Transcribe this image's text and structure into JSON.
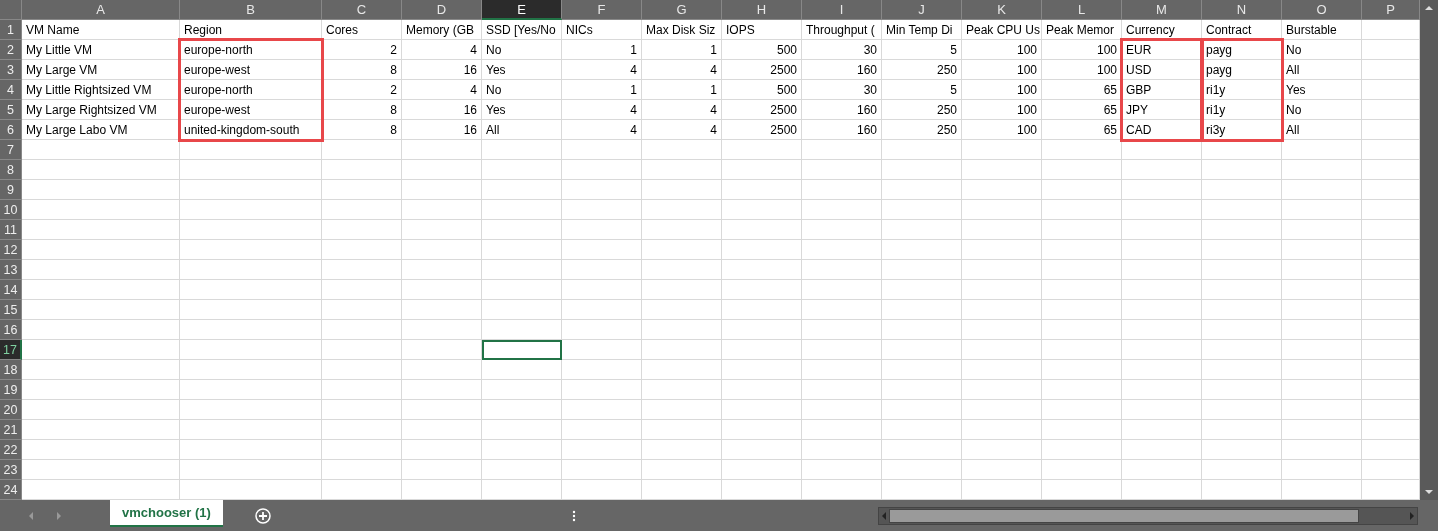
{
  "columns": [
    {
      "letter": "A",
      "header": "VM Name",
      "kind": "text",
      "selected": false,
      "highlighted": false
    },
    {
      "letter": "B",
      "header": "Region",
      "kind": "text",
      "selected": false,
      "highlighted": true
    },
    {
      "letter": "C",
      "header": "Cores",
      "kind": "number",
      "selected": false,
      "highlighted": false
    },
    {
      "letter": "D",
      "header": "Memory (GB",
      "kind": "number",
      "selected": false,
      "highlighted": false
    },
    {
      "letter": "E",
      "header": "SSD [Yes/No",
      "kind": "text",
      "selected": true,
      "highlighted": false
    },
    {
      "letter": "F",
      "header": "NICs",
      "kind": "number",
      "selected": false,
      "highlighted": false
    },
    {
      "letter": "G",
      "header": "Max Disk Siz",
      "kind": "number",
      "selected": false,
      "highlighted": false
    },
    {
      "letter": "H",
      "header": "IOPS",
      "kind": "number",
      "selected": false,
      "highlighted": false
    },
    {
      "letter": "I",
      "header": "Throughput (",
      "kind": "number",
      "selected": false,
      "highlighted": false
    },
    {
      "letter": "J",
      "header": "Min Temp Di",
      "kind": "number",
      "selected": false,
      "highlighted": false
    },
    {
      "letter": "K",
      "header": "Peak CPU Us",
      "kind": "number",
      "selected": false,
      "highlighted": false
    },
    {
      "letter": "L",
      "header": "Peak Memor",
      "kind": "number",
      "selected": false,
      "highlighted": false
    },
    {
      "letter": "M",
      "header": "Currency",
      "kind": "text",
      "selected": false,
      "highlighted": true
    },
    {
      "letter": "N",
      "header": "Contract",
      "kind": "text",
      "selected": false,
      "highlighted": true
    },
    {
      "letter": "O",
      "header": "Burstable",
      "kind": "text",
      "selected": false,
      "highlighted": false
    },
    {
      "letter": "P",
      "kind": "text",
      "selected": false,
      "highlighted": false
    }
  ],
  "rows": [
    {
      "number": "2",
      "selected": false,
      "cells": [
        "My Little VM",
        "europe-north",
        "2",
        "4",
        "No",
        "1",
        "1",
        "500",
        "30",
        "5",
        "100",
        "100",
        "EUR",
        "payg",
        "No"
      ]
    },
    {
      "number": "3",
      "selected": false,
      "cells": [
        "My Large VM",
        "europe-west",
        "8",
        "16",
        "Yes",
        "4",
        "4",
        "2500",
        "160",
        "250",
        "100",
        "100",
        "USD",
        "payg",
        "All"
      ]
    },
    {
      "number": "4",
      "selected": false,
      "cells": [
        "My Little Rightsized VM",
        "europe-north",
        "2",
        "4",
        "No",
        "1",
        "1",
        "500",
        "30",
        "5",
        "100",
        "65",
        "GBP",
        "ri1y",
        "Yes"
      ]
    },
    {
      "number": "5",
      "selected": false,
      "cells": [
        "My Large Rightsized VM",
        "europe-west",
        "8",
        "16",
        "Yes",
        "4",
        "4",
        "2500",
        "160",
        "250",
        "100",
        "65",
        "JPY",
        "ri1y",
        "No"
      ]
    },
    {
      "number": "6",
      "selected": false,
      "cells": [
        "My Large Labo VM",
        "united-kingdom-south",
        "8",
        "16",
        "All",
        "4",
        "4",
        "2500",
        "160",
        "250",
        "100",
        "65",
        "CAD",
        "ri3y",
        "All"
      ]
    },
    {
      "number": "7",
      "selected": false
    },
    {
      "number": "8",
      "selected": false
    },
    {
      "number": "9",
      "selected": false
    },
    {
      "number": "10",
      "selected": false
    },
    {
      "number": "11",
      "selected": false
    },
    {
      "number": "12",
      "selected": false
    },
    {
      "number": "13",
      "selected": false
    },
    {
      "number": "14",
      "selected": false
    },
    {
      "number": "15",
      "selected": false
    },
    {
      "number": "16",
      "selected": false
    },
    {
      "number": "17",
      "selected": true
    },
    {
      "number": "18",
      "selected": false
    },
    {
      "number": "19",
      "selected": false
    },
    {
      "number": "20",
      "selected": false
    },
    {
      "number": "21",
      "selected": false
    },
    {
      "number": "22",
      "selected": false
    },
    {
      "number": "23",
      "selected": false
    },
    {
      "number": "24",
      "selected": false
    }
  ],
  "header_row_number": "1",
  "sheet_tabs": [
    {
      "label": "vmchooser (1)",
      "selected": true
    }
  ]
}
